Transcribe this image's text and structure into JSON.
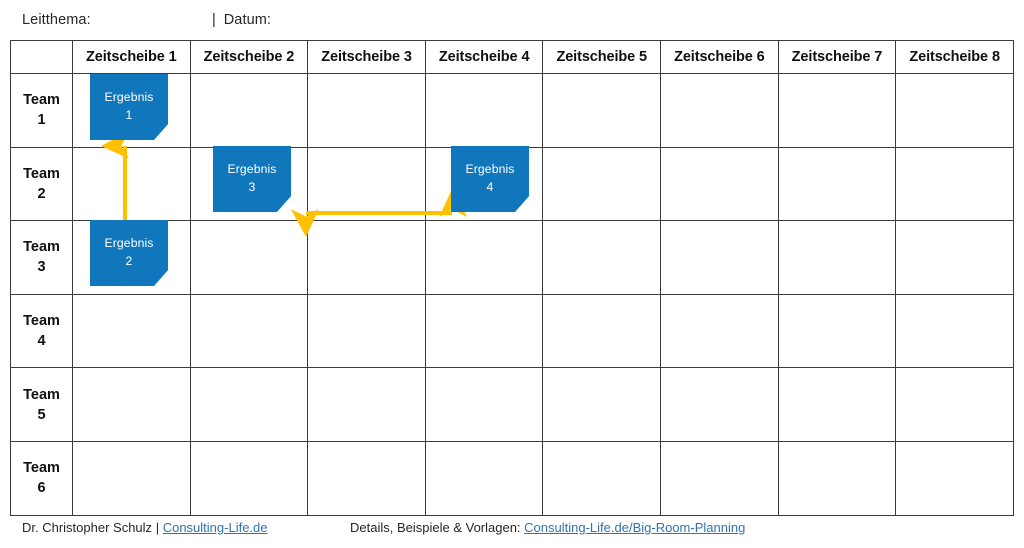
{
  "meta": {
    "leitthema_label": "Leitthema:",
    "separator": "|",
    "datum_label": "Datum:"
  },
  "board": {
    "corner_header": "",
    "column_headers": [
      "Zeitscheibe 1",
      "Zeitscheibe 2",
      "Zeitscheibe 3",
      "Zeitscheibe 4",
      "Zeitscheibe 5",
      "Zeitscheibe 6",
      "Zeitscheibe 7",
      "Zeitscheibe 8"
    ],
    "row_headers": [
      {
        "line1": "Team",
        "line2": "1"
      },
      {
        "line1": "Team",
        "line2": "2"
      },
      {
        "line1": "Team",
        "line2": "3"
      },
      {
        "line1": "Team",
        "line2": "4"
      },
      {
        "line1": "Team",
        "line2": "5"
      },
      {
        "line1": "Team",
        "line2": "6"
      }
    ],
    "notes": [
      {
        "id": "note-1",
        "row": "Team 1",
        "column": "Zeitscheibe 1",
        "line1": "Ergebnis",
        "line2": "1"
      },
      {
        "id": "note-3",
        "row": "Team 2",
        "column": "Zeitscheibe 2",
        "line1": "Ergebnis",
        "line2": "3"
      },
      {
        "id": "note-4",
        "row": "Team 2",
        "column": "Zeitscheibe 4",
        "line1": "Ergebnis",
        "line2": "4"
      },
      {
        "id": "note-2",
        "row": "Team 3",
        "column": "Zeitscheibe 1",
        "line1": "Ergebnis",
        "line2": "2"
      }
    ],
    "dependencies": [
      {
        "id": "dep-vertical",
        "orientation": "vertical",
        "from": "Ergebnis 1",
        "to": "Ergebnis 2",
        "style": "double-headed"
      },
      {
        "id": "dep-horizontal",
        "orientation": "horizontal",
        "from": "Ergebnis 3",
        "to": "Ergebnis 4",
        "style": "double-headed"
      }
    ]
  },
  "colors": {
    "note_fill": "#1077BD",
    "note_fold": "#2F8FD4",
    "arrow": "#FFC000",
    "grid": "#3b3b3b",
    "link": "#2E74B5"
  },
  "footer": {
    "author": "Dr. Christopher Schulz",
    "separator": "|",
    "author_link": "Consulting-Life.de",
    "details_label": "Details, Beispiele & Vorlagen:",
    "details_link": "Consulting-Life.de/Big-Room-Planning"
  }
}
